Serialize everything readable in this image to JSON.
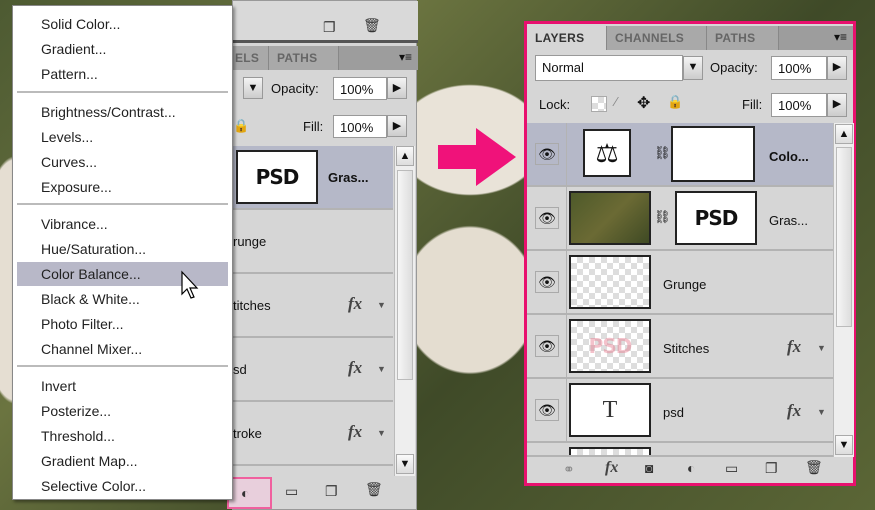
{
  "left_panel": {
    "tabs": [
      "ELS",
      "PATHS"
    ],
    "opacity_label": "Opacity:",
    "opacity_value": "100%",
    "fill_label": "Fill:",
    "fill_value": "100%",
    "layers": [
      {
        "name": "Gras...",
        "thumb": "PSD",
        "selected": true
      },
      {
        "name": "runge"
      },
      {
        "name": "titches",
        "fx": "fx"
      },
      {
        "name": "sd",
        "fx": "fx"
      },
      {
        "name": "troke",
        "fx": "fx"
      }
    ]
  },
  "menu": {
    "groups": [
      [
        "Solid Color...",
        "Gradient...",
        "Pattern..."
      ],
      [
        "Brightness/Contrast...",
        "Levels...",
        "Curves...",
        "Exposure..."
      ],
      [
        "Vibrance...",
        "Hue/Saturation...",
        "Color Balance...",
        "Black & White...",
        "Photo Filter...",
        "Channel Mixer..."
      ],
      [
        "Invert",
        "Posterize...",
        "Threshold...",
        "Gradient Map...",
        "Selective Color..."
      ]
    ],
    "highlighted": "Color Balance..."
  },
  "right_panel": {
    "tabs": [
      "LAYERS",
      "CHANNELS",
      "PATHS"
    ],
    "blend_mode": "Normal",
    "opacity_label": "Opacity:",
    "opacity_value": "100%",
    "lock_label": "Lock:",
    "fill_label": "Fill:",
    "fill_value": "100%",
    "layers": [
      {
        "name": "Colo...",
        "selected": true
      },
      {
        "name": "Gras...",
        "mask": "PSD"
      },
      {
        "name": "Grunge"
      },
      {
        "name": "Stitches",
        "fx": "fx",
        "thumb_text": "PSD"
      },
      {
        "name": "psd",
        "fx": "fx",
        "thumb": "T"
      }
    ],
    "toolbar_fx": "fx"
  },
  "colors": {
    "highlight": "#e8106e",
    "selected_row": "#b5b8c8",
    "menu_highlight": "#b8b8c8"
  }
}
